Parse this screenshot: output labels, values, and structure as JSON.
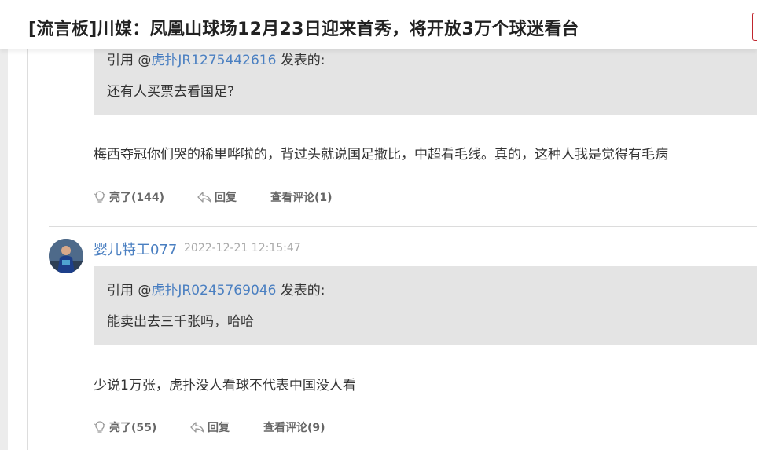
{
  "header": {
    "title": "[流言板]川媒：凤凰山球场12月23日迎来首秀，将开放3万个球迷看台"
  },
  "comments": [
    {
      "quote": {
        "prefix": "引用 @",
        "user": "虎扑JR1275442616",
        "suffix": " 发表的:",
        "text": "还有人买票去看国足?"
      },
      "text": "梅西夺冠你们哭的稀里哗啦的，背过头就说国足撒比，中超看毛线。真的，这种人我是觉得有毛病",
      "actions": {
        "like": "亮了(144)",
        "reply": "回复",
        "view": "查看评论(1)"
      }
    },
    {
      "username": "婴儿特工077",
      "timestamp": "2022-12-21 12:15:47",
      "quote": {
        "prefix": "引用 @",
        "user": "虎扑JR0245769046",
        "suffix": " 发表的:",
        "text": "能卖出去三千张吗，哈哈"
      },
      "text": "少说1万张，虎扑没人看球不代表中国没人看",
      "actions": {
        "like": "亮了(55)",
        "reply": "回复",
        "view": "查看评论(9)"
      }
    }
  ],
  "colors": {
    "link": "#4a7fc1",
    "quote_bg": "#e4e4e4",
    "brand_red": "#c0262e"
  }
}
